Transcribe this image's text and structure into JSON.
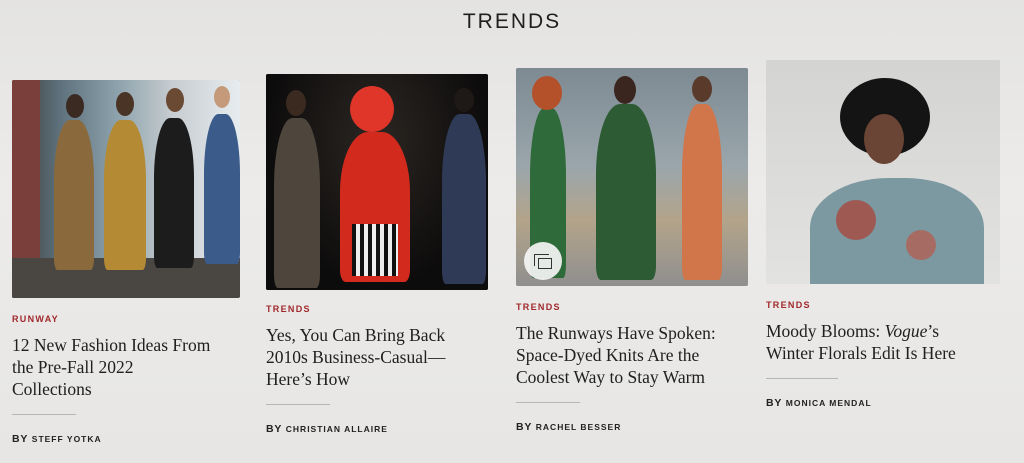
{
  "section": {
    "title": "TRENDS"
  },
  "cards": [
    {
      "kicker": "RUNWAY",
      "headline": [
        "12 New Fashion Ideas From",
        "the Pre-Fall 2022",
        "Collections"
      ],
      "by": "BY",
      "author": "STEFF YOTKA",
      "image_desc_icon": "runway-photo"
    },
    {
      "kicker": "TRENDS",
      "headline": [
        "Yes, You Can Bring Back",
        "2010s Business-Casual—",
        "Here’s How"
      ],
      "by": "BY",
      "author": "CHRISTIAN ALLAIRE",
      "image_desc_icon": "runway-photo"
    },
    {
      "kicker": "TRENDS",
      "headline": [
        "The Runways Have Spoken:",
        "Space-Dyed Knits Are the",
        "Coolest Way to Stay Warm"
      ],
      "by": "BY",
      "author": "RACHEL BESSER",
      "image_desc_icon": "runway-photo",
      "gallery_icon": "gallery-icon"
    },
    {
      "kicker": "TRENDS",
      "headline_pre": "Moody Blooms: ",
      "headline_italic": "Vogue",
      "headline_post_line1": "’s",
      "headline_line2": "Winter Florals Edit Is Here",
      "by": "BY",
      "author": "MONICA MENDAL",
      "image_desc_icon": "portrait-photo"
    }
  ],
  "colors": {
    "kicker": "#a0282b",
    "text": "#202020",
    "background": "#e9e8e6"
  }
}
